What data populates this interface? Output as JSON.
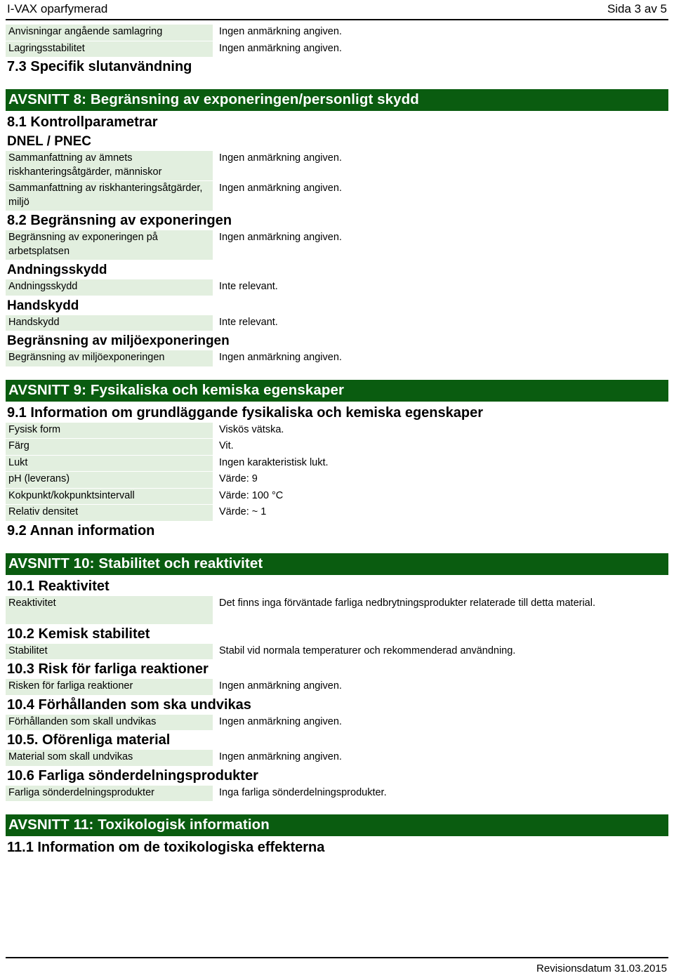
{
  "header": {
    "document_title": "I-VAX oparfymerad",
    "page_indicator": "Sida 3 av 5"
  },
  "footer": {
    "revision_text": "Revisionsdatum 31.03.2015"
  },
  "colors": {
    "section_bar_bg": "#0a5c10",
    "section_bar_text": "#ffffff",
    "label_cell_bg": "#e2efdf",
    "body_text": "#000000"
  },
  "common_values": {
    "no_remark": "Ingen anmärkning angiven.",
    "not_relevant": "Inte relevant."
  },
  "top_rows": [
    {
      "label": "Anvisningar angående samlagring",
      "value": "Ingen anmärkning angiven."
    },
    {
      "label": "Lagringsstabilitet",
      "value": "Ingen anmärkning angiven."
    }
  ],
  "heading_7_3": "7.3 Specifik slutanvändning",
  "section_8": {
    "bar_title": "AVSNITT 8: Begränsning av exponeringen/personligt skydd",
    "heading_8_1": "8.1 Kontrollparametrar",
    "subheading_dnel": "DNEL / PNEC",
    "rows_8_1": [
      {
        "label": "Sammanfattning av ämnets riskhanteringsåtgärder, människor",
        "value": "Ingen anmärkning angiven."
      },
      {
        "label": "Sammanfattning av riskhanteringsåtgärder, miljö",
        "value": "Ingen anmärkning angiven."
      }
    ],
    "heading_8_2": "8.2 Begränsning av exponeringen",
    "rows_8_2": [
      {
        "label": "Begränsning av exponeringen på arbetsplatsen",
        "value": "Ingen anmärkning angiven."
      }
    ],
    "subheading_andningsskydd": "Andningsskydd",
    "rows_andningsskydd": [
      {
        "label": "Andningsskydd",
        "value": "Inte relevant."
      }
    ],
    "subheading_handskydd": "Handskydd",
    "rows_handskydd": [
      {
        "label": "Handskydd",
        "value": "Inte relevant."
      }
    ],
    "subheading_miljoexponering": "Begränsning av miljöexponeringen",
    "rows_miljoexponering": [
      {
        "label": "Begränsning av miljöexponeringen",
        "value": "Ingen anmärkning angiven."
      }
    ]
  },
  "section_9": {
    "bar_title": "AVSNITT 9: Fysikaliska och kemiska egenskaper",
    "heading_9_1": "9.1 Information om grundläggande fysikaliska och kemiska egenskaper",
    "rows": [
      {
        "label": "Fysisk form",
        "value": "Viskös vätska."
      },
      {
        "label": "Färg",
        "value": "Vit."
      },
      {
        "label": "Lukt",
        "value": "Ingen karakteristisk lukt."
      },
      {
        "label": "pH (leverans)",
        "value": "Värde: 9"
      },
      {
        "label": "Kokpunkt/kokpunktsintervall",
        "value": "Värde: 100 °C"
      },
      {
        "label": "Relativ densitet",
        "value": "Värde: ~ 1"
      }
    ],
    "heading_9_2": "9.2 Annan information"
  },
  "section_10": {
    "bar_title": "AVSNITT 10: Stabilitet och reaktivitet",
    "heading_10_1": "10.1 Reaktivitet",
    "rows_10_1": [
      {
        "label": "Reaktivitet",
        "value": "Det finns inga förväntade farliga nedbrytningsprodukter relaterade till detta material."
      }
    ],
    "heading_10_2": "10.2 Kemisk stabilitet",
    "rows_10_2": [
      {
        "label": "Stabilitet",
        "value": "Stabil vid normala temperaturer och rekommenderad användning."
      }
    ],
    "heading_10_3": "10.3 Risk för farliga reaktioner",
    "rows_10_3": [
      {
        "label": "Risken för farliga reaktioner",
        "value": "Ingen anmärkning angiven."
      }
    ],
    "heading_10_4": "10.4 Förhållanden som ska undvikas",
    "rows_10_4": [
      {
        "label": "Förhållanden som skall undvikas",
        "value": "Ingen anmärkning angiven."
      }
    ],
    "heading_10_5": "10.5. Oförenliga material",
    "rows_10_5": [
      {
        "label": "Material som skall undvikas",
        "value": "Ingen anmärkning angiven."
      }
    ],
    "heading_10_6": "10.6 Farliga sönderdelningsprodukter",
    "rows_10_6": [
      {
        "label": "Farliga sönderdelningsprodukter",
        "value": "Inga farliga sönderdelningsprodukter."
      }
    ]
  },
  "section_11": {
    "bar_title": "AVSNITT 11: Toxikologisk information",
    "heading_11_1": "11.1 Information om de toxikologiska effekterna"
  }
}
